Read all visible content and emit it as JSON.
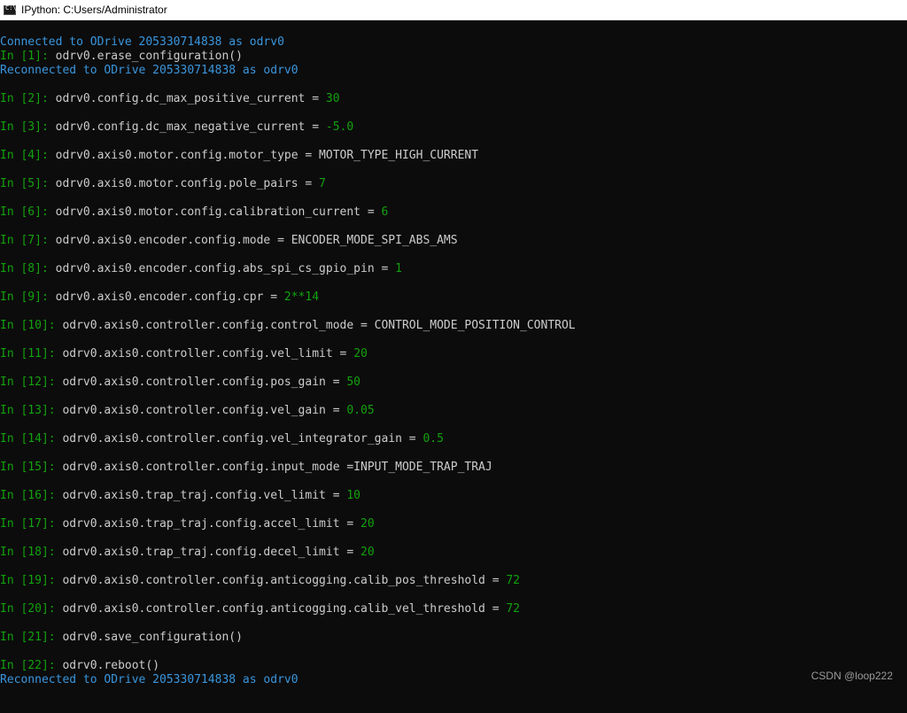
{
  "window": {
    "title": "IPython: C:Users/Administrator",
    "icon": "console-icon",
    "icon_glyph": "C:\\"
  },
  "console": {
    "connected": "Connected to ODrive 205330714838 as odrv0",
    "reconnected": "Reconnected to ODrive 205330714838 as odrv0",
    "cells": [
      {
        "prompt": "In [1]: ",
        "code": "odrv0.erase_configuration()",
        "value": ""
      },
      {
        "prompt": "In [2]: ",
        "code": "odrv0.config.dc_max_positive_current = ",
        "value": "30"
      },
      {
        "prompt": "In [3]: ",
        "code": "odrv0.config.dc_max_negative_current = ",
        "value": "-5.0"
      },
      {
        "prompt": "In [4]: ",
        "code": "odrv0.axis0.motor.config.motor_type = MOTOR_TYPE_HIGH_CURRENT",
        "value": ""
      },
      {
        "prompt": "In [5]: ",
        "code": "odrv0.axis0.motor.config.pole_pairs = ",
        "value": "7"
      },
      {
        "prompt": "In [6]: ",
        "code": "odrv0.axis0.motor.config.calibration_current = ",
        "value": "6"
      },
      {
        "prompt": "In [7]: ",
        "code": "odrv0.axis0.encoder.config.mode = ENCODER_MODE_SPI_ABS_AMS",
        "value": ""
      },
      {
        "prompt": "In [8]: ",
        "code": "odrv0.axis0.encoder.config.abs_spi_cs_gpio_pin = ",
        "value": "1"
      },
      {
        "prompt": "In [9]: ",
        "code": "odrv0.axis0.encoder.config.cpr = ",
        "value": "2**14"
      },
      {
        "prompt": "In [10]: ",
        "code": "odrv0.axis0.controller.config.control_mode = CONTROL_MODE_POSITION_CONTROL",
        "value": ""
      },
      {
        "prompt": "In [11]: ",
        "code": "odrv0.axis0.controller.config.vel_limit = ",
        "value": "20"
      },
      {
        "prompt": "In [12]: ",
        "code": "odrv0.axis0.controller.config.pos_gain = ",
        "value": "50"
      },
      {
        "prompt": "In [13]: ",
        "code": "odrv0.axis0.controller.config.vel_gain = ",
        "value": "0.05"
      },
      {
        "prompt": "In [14]: ",
        "code": "odrv0.axis0.controller.config.vel_integrator_gain = ",
        "value": "0.5"
      },
      {
        "prompt": "In [15]: ",
        "code": "odrv0.axis0.controller.config.input_mode =INPUT_MODE_TRAP_TRAJ",
        "value": ""
      },
      {
        "prompt": "In [16]: ",
        "code": "odrv0.axis0.trap_traj.config.vel_limit = ",
        "value": "10"
      },
      {
        "prompt": "In [17]: ",
        "code": "odrv0.axis0.trap_traj.config.accel_limit = ",
        "value": "20"
      },
      {
        "prompt": "In [18]: ",
        "code": "odrv0.axis0.trap_traj.config.decel_limit = ",
        "value": "20"
      },
      {
        "prompt": "In [19]: ",
        "code": "odrv0.axis0.controller.config.anticogging.calib_pos_threshold = ",
        "value": "72"
      },
      {
        "prompt": "In [20]: ",
        "code": "odrv0.axis0.controller.config.anticogging.calib_vel_threshold = ",
        "value": "72"
      },
      {
        "prompt": "In [21]: ",
        "code": "odrv0.save_configuration()",
        "value": ""
      },
      {
        "prompt": "In [22]: ",
        "code": "odrv0.reboot()",
        "value": ""
      }
    ]
  },
  "watermark": "CSDN @loop222",
  "colors": {
    "background": "#0c0c0c",
    "cyan": "#3a96dd",
    "green": "#13a10e",
    "text": "#cccccc"
  }
}
